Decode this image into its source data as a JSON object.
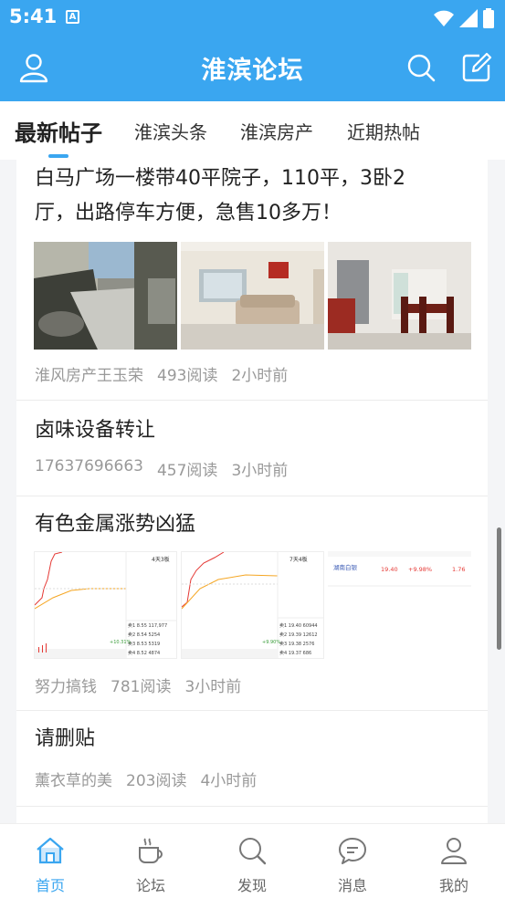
{
  "status_bar": {
    "time": "5:41",
    "notification_letter": "A"
  },
  "app_bar": {
    "title": "淮滨论坛"
  },
  "tabs": [
    {
      "label": "最新帖子",
      "active": true
    },
    {
      "label": "淮滨头条",
      "active": false
    },
    {
      "label": "淮滨房产",
      "active": false
    },
    {
      "label": "近期热帖",
      "active": false
    }
  ],
  "posts": [
    {
      "title_line1": "白马广场一楼带40平院子，110平，3卧2",
      "title_line2": "厅，出路停车方便，急售10多万！",
      "author": "淮风房产王玉荣",
      "reads": "493阅读",
      "time": "2小时前"
    },
    {
      "title_line1": "卤味设备转让",
      "author": "17637696663",
      "reads": "457阅读",
      "time": "3小时前"
    },
    {
      "title_line1": "有色金属涨势凶猛",
      "author": "努力搞钱",
      "reads": "781阅读",
      "time": "3小时前"
    },
    {
      "title_line1": "请删贴",
      "author": "薰衣草的美",
      "reads": "203阅读",
      "time": "4小时前"
    }
  ],
  "stock_thumbs": {
    "t1_header": "4天3板",
    "t2_header": "7天4板",
    "t1_rows": [
      "卖1 8.55 117,977",
      "卖2 8.54 5254",
      "卖3 8.53 5319",
      "卖4 8.52 4874"
    ],
    "t2_rows": [
      "卖1 19.40 60944",
      "卖2 19.39 12612",
      "卖3 19.38 2576",
      "卖4 19.37 686"
    ],
    "t1_change": "+10.31%",
    "t2_change": "+9.90%",
    "t3_name": "湖南白银",
    "t3_price": "19.40",
    "t3_change": "+9.98%",
    "t3_extra": "1.76"
  },
  "bottom_nav": [
    {
      "label": "首页",
      "icon": "home-icon",
      "active": true
    },
    {
      "label": "论坛",
      "icon": "coffee-icon",
      "active": false
    },
    {
      "label": "发现",
      "icon": "search-icon",
      "active": false
    },
    {
      "label": "消息",
      "icon": "message-icon",
      "active": false
    },
    {
      "label": "我的",
      "icon": "profile-icon",
      "active": false
    }
  ],
  "colors": {
    "primary": "#3aa6f0",
    "meta_text": "#999999",
    "stock_up": "#e53935"
  }
}
